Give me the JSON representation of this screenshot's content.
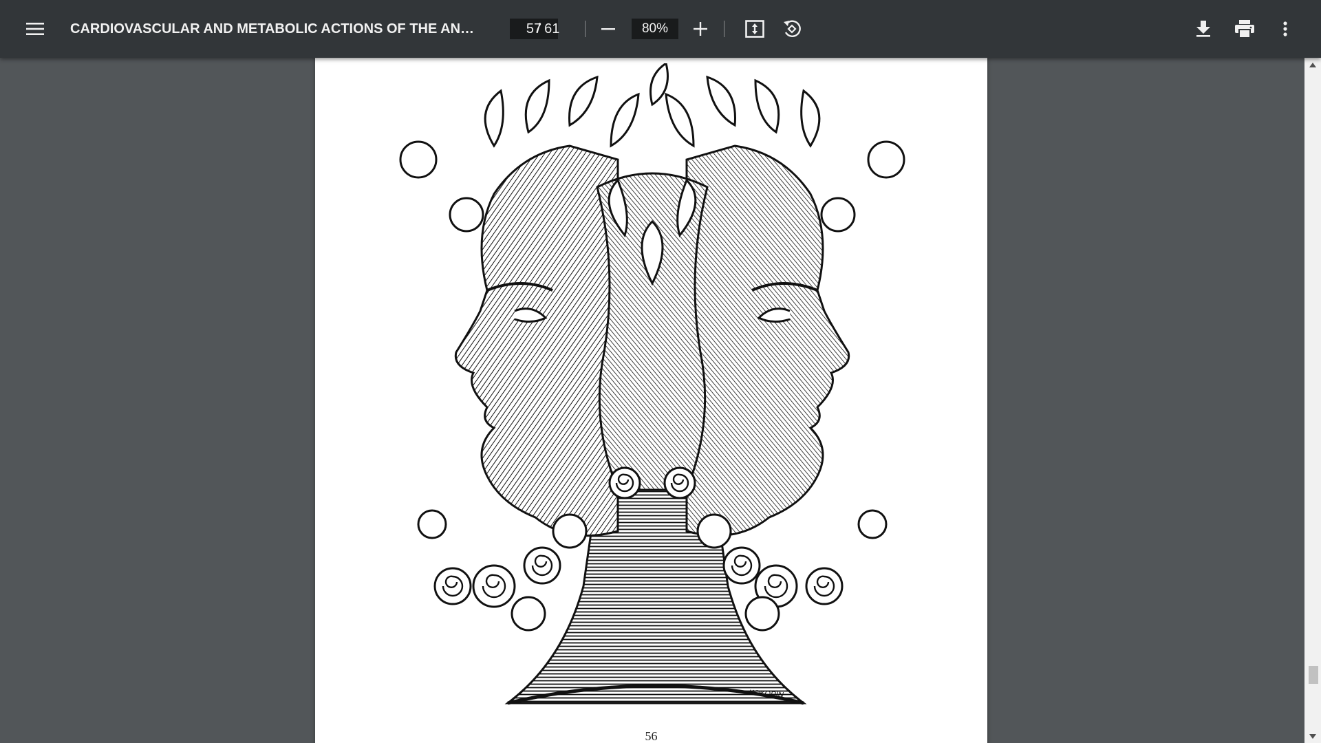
{
  "toolbar": {
    "document_title": "CARDIOVASCULAR AND METABOLIC ACTIONS OF THE ANDRO...",
    "current_page": "57",
    "page_separator": "/ 61",
    "zoom_level": "80%",
    "icons": {
      "menu": "hamburger-menu-icon",
      "zoom_out": "minus-icon",
      "zoom_in": "plus-icon",
      "fit_page": "fit-to-page-icon",
      "rotate": "rotate-counterclockwise-icon",
      "download": "download-icon",
      "print": "printer-icon",
      "more": "more-vertical-icon"
    }
  },
  "document": {
    "page_number": "56",
    "signature_text": "KOKORIN"
  },
  "colors": {
    "toolbar_bg": "#323639",
    "viewer_bg": "#525659",
    "page_bg": "#ffffff",
    "input_bg": "#191b1c"
  }
}
